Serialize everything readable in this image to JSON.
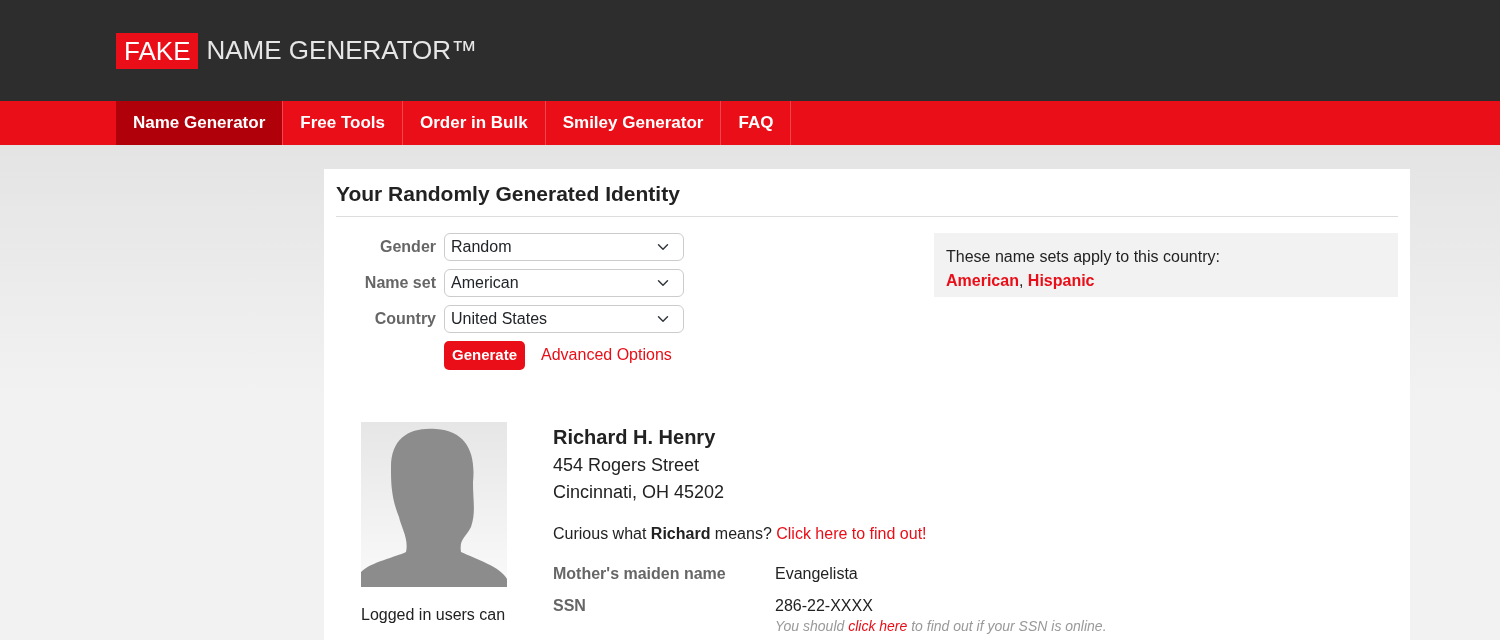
{
  "logo": {
    "badge": "FAKE",
    "text": "NAME GENERATOR™"
  },
  "nav": [
    {
      "label": "Name Generator",
      "selected": true
    },
    {
      "label": "Free Tools",
      "selected": false
    },
    {
      "label": "Order in Bulk",
      "selected": false
    },
    {
      "label": "Smiley Generator",
      "selected": false
    },
    {
      "label": "FAQ",
      "selected": false
    }
  ],
  "title": "Your Randomly Generated Identity",
  "form": {
    "fields": [
      {
        "label": "Gender",
        "value": "Random"
      },
      {
        "label": "Name set",
        "value": "American"
      },
      {
        "label": "Country",
        "value": "United States"
      }
    ],
    "generate": "Generate",
    "advanced": "Advanced Options"
  },
  "name_sets": {
    "intro": "These name sets apply to this country:",
    "separator": ",",
    "items": [
      "American",
      "Hispanic"
    ]
  },
  "identity": {
    "photo_caption": "Logged in users can",
    "name": "Richard H. Henry",
    "address": [
      "454 Rogers Street",
      "Cincinnati, OH 45202"
    ],
    "meaning": {
      "text": "Curious what **Richard** means?",
      "link": "Click here to find out!"
    },
    "details": [
      {
        "label": "Mother's maiden name",
        "value": "Evangelista"
      },
      {
        "label": "SSN",
        "value": "286-22-XXXX",
        "note": {
          "before": "You should",
          "link": "click here",
          "after": "to find out if your SSN is online."
        }
      }
    ]
  }
}
